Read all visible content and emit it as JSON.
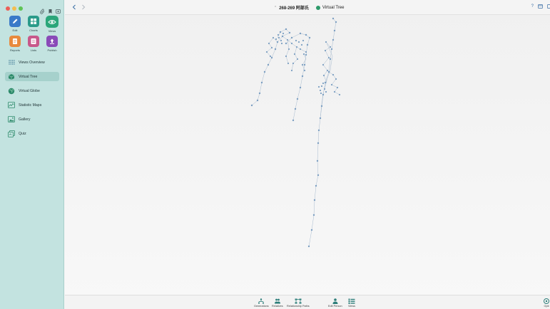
{
  "sidebar": {
    "buttons": [
      {
        "label": "Edit",
        "icon": "pencil-icon",
        "color": "#3a7ac8"
      },
      {
        "label": "Charts",
        "icon": "charts-icon",
        "color": "#2b9b8a"
      },
      {
        "label": "Views",
        "icon": "eye-icon",
        "color": "#2ba67a"
      },
      {
        "label": "Reports",
        "icon": "document-icon",
        "color": "#e88a3d"
      },
      {
        "label": "Lists",
        "icon": "list-icon",
        "color": "#c8588a"
      },
      {
        "label": "Publish",
        "icon": "upload-icon",
        "color": "#8a4ab8"
      }
    ],
    "items": [
      {
        "label": "Views Overview",
        "icon": "grid-dots-icon"
      },
      {
        "label": "Virtual Tree",
        "icon": "cube-icon"
      },
      {
        "label": "Virtual Globe",
        "icon": "globe-icon"
      },
      {
        "label": "Statistic Maps",
        "icon": "map-icon"
      },
      {
        "label": "Gallery",
        "icon": "gallery-icon"
      },
      {
        "label": "Quiz",
        "icon": "quiz-icon"
      }
    ],
    "selected": "Virtual Tree"
  },
  "titlebar": {
    "database": "268-269 阿部氏",
    "view": "Virtual Tree"
  },
  "bottombar": {
    "buttons": [
      {
        "label": "Generations",
        "icon": "generations-icon"
      },
      {
        "label": "Relatives",
        "icon": "relatives-icon"
      },
      {
        "label": "Relationship Paths",
        "icon": "relationship-paths-icon"
      },
      {
        "label": "Edit Person",
        "icon": "edit-person-icon"
      },
      {
        "label": "Views",
        "icon": "views-icon"
      }
    ],
    "right_label": "Opti"
  },
  "colors": {
    "sidebar_bg": "#c3e3e0",
    "accent": "#3a6ea5",
    "tree_node": "#7c9fc2"
  }
}
